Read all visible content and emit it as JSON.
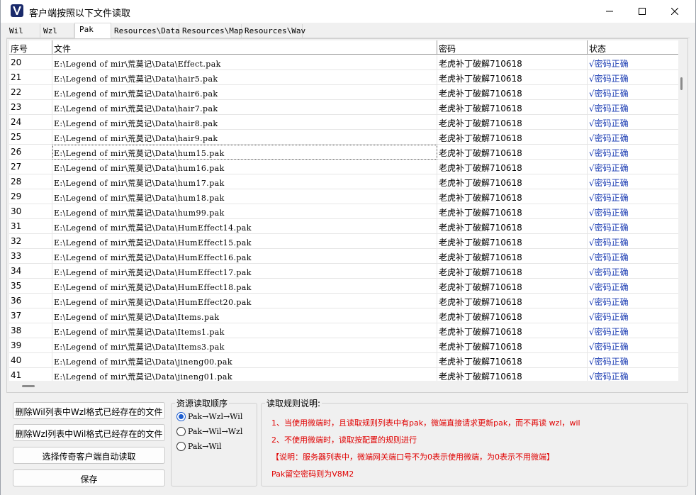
{
  "window": {
    "title": "客户端按照以下文件读取"
  },
  "tabs": [
    {
      "label": "Wil"
    },
    {
      "label": "Wzl"
    },
    {
      "label": "Pak"
    },
    {
      "label": "Resources\\Data"
    },
    {
      "label": "Resources\\Map"
    },
    {
      "label": "Resources\\Wav"
    }
  ],
  "table": {
    "headers": {
      "idx": "序号",
      "file": "文件",
      "pwd": "密码",
      "status": "状态"
    },
    "rows": [
      {
        "idx": "20",
        "file": "E:\\Legend of mir\\荒莫记\\Data\\Effect.pak",
        "pwd": "老虎补丁破解710618",
        "status": "√密码正确"
      },
      {
        "idx": "21",
        "file": "E:\\Legend of mir\\荒莫记\\Data\\hair5.pak",
        "pwd": "老虎补丁破解710618",
        "status": "√密码正确"
      },
      {
        "idx": "22",
        "file": "E:\\Legend of mir\\荒莫记\\Data\\hair6.pak",
        "pwd": "老虎补丁破解710618",
        "status": "√密码正确"
      },
      {
        "idx": "23",
        "file": "E:\\Legend of mir\\荒莫记\\Data\\hair7.pak",
        "pwd": "老虎补丁破解710618",
        "status": "√密码正确"
      },
      {
        "idx": "24",
        "file": "E:\\Legend of mir\\荒莫记\\Data\\hair8.pak",
        "pwd": "老虎补丁破解710618",
        "status": "√密码正确"
      },
      {
        "idx": "25",
        "file": "E:\\Legend of mir\\荒莫记\\Data\\hair9.pak",
        "pwd": "老虎补丁破解710618",
        "status": "√密码正确"
      },
      {
        "idx": "26",
        "file": "E:\\Legend of mir\\荒莫记\\Data\\hum15.pak",
        "pwd": "老虎补丁破解710618",
        "status": "√密码正确"
      },
      {
        "idx": "27",
        "file": "E:\\Legend of mir\\荒莫记\\Data\\hum16.pak",
        "pwd": "老虎补丁破解710618",
        "status": "√密码正确"
      },
      {
        "idx": "28",
        "file": "E:\\Legend of mir\\荒莫记\\Data\\hum17.pak",
        "pwd": "老虎补丁破解710618",
        "status": "√密码正确"
      },
      {
        "idx": "29",
        "file": "E:\\Legend of mir\\荒莫记\\Data\\hum18.pak",
        "pwd": "老虎补丁破解710618",
        "status": "√密码正确"
      },
      {
        "idx": "30",
        "file": "E:\\Legend of mir\\荒莫记\\Data\\hum99.pak",
        "pwd": "老虎补丁破解710618",
        "status": "√密码正确"
      },
      {
        "idx": "31",
        "file": "E:\\Legend of mir\\荒莫记\\Data\\HumEffect14.pak",
        "pwd": "老虎补丁破解710618",
        "status": "√密码正确"
      },
      {
        "idx": "32",
        "file": "E:\\Legend of mir\\荒莫记\\Data\\HumEffect15.pak",
        "pwd": "老虎补丁破解710618",
        "status": "√密码正确"
      },
      {
        "idx": "33",
        "file": "E:\\Legend of mir\\荒莫记\\Data\\HumEffect16.pak",
        "pwd": "老虎补丁破解710618",
        "status": "√密码正确"
      },
      {
        "idx": "34",
        "file": "E:\\Legend of mir\\荒莫记\\Data\\HumEffect17.pak",
        "pwd": "老虎补丁破解710618",
        "status": "√密码正确"
      },
      {
        "idx": "35",
        "file": "E:\\Legend of mir\\荒莫记\\Data\\HumEffect18.pak",
        "pwd": "老虎补丁破解710618",
        "status": "√密码正确"
      },
      {
        "idx": "36",
        "file": "E:\\Legend of mir\\荒莫记\\Data\\HumEffect20.pak",
        "pwd": "老虎补丁破解710618",
        "status": "√密码正确"
      },
      {
        "idx": "37",
        "file": "E:\\Legend of mir\\荒莫记\\Data\\Items.pak",
        "pwd": "老虎补丁破解710618",
        "status": "√密码正确"
      },
      {
        "idx": "38",
        "file": "E:\\Legend of mir\\荒莫记\\Data\\Items1.pak",
        "pwd": "老虎补丁破解710618",
        "status": "√密码正确"
      },
      {
        "idx": "39",
        "file": "E:\\Legend of mir\\荒莫记\\Data\\Items3.pak",
        "pwd": "老虎补丁破解710618",
        "status": "√密码正确"
      },
      {
        "idx": "40",
        "file": "E:\\Legend of mir\\荒莫记\\Data\\jineng00.pak",
        "pwd": "老虎补丁破解710618",
        "status": "√密码正确"
      },
      {
        "idx": "41",
        "file": "E:\\Legend of mir\\荒莫记\\Data\\jineng01.pak",
        "pwd": "老虎补丁破解710618",
        "status": "√密码正确"
      }
    ]
  },
  "buttons": {
    "delete_wil": "删除Wil列表中Wzl格式已经存在的文件",
    "delete_wzl": "删除Wzl列表中Wil格式已经存在的文件",
    "select_client": "选择传奇客户端自动读取",
    "save": "保存"
  },
  "read_order": {
    "title": "资源读取顺序",
    "options": [
      {
        "label": "Pak→Wzl→Wil",
        "checked": true
      },
      {
        "label": "Pak→Wil→Wzl",
        "checked": false
      },
      {
        "label": "Pak→Wil",
        "checked": false
      }
    ]
  },
  "rules": {
    "title": "读取规则说明:",
    "lines": [
      "1、当使用微端时，且读取规则列表中有pak，微端直接请求更新pak，而不再读 wzl，wil",
      "2、不使用微端时，读取按配置的规则进行",
      "【说明：服务器列表中，微端网关端口号不为0表示使用微端，为0表示不用微端】",
      "Pak留空密码则为V8M2"
    ],
    "color": "#e00000"
  },
  "colors": {
    "status": "#1e3fb4",
    "radio_accent": "#1e5ecf"
  }
}
